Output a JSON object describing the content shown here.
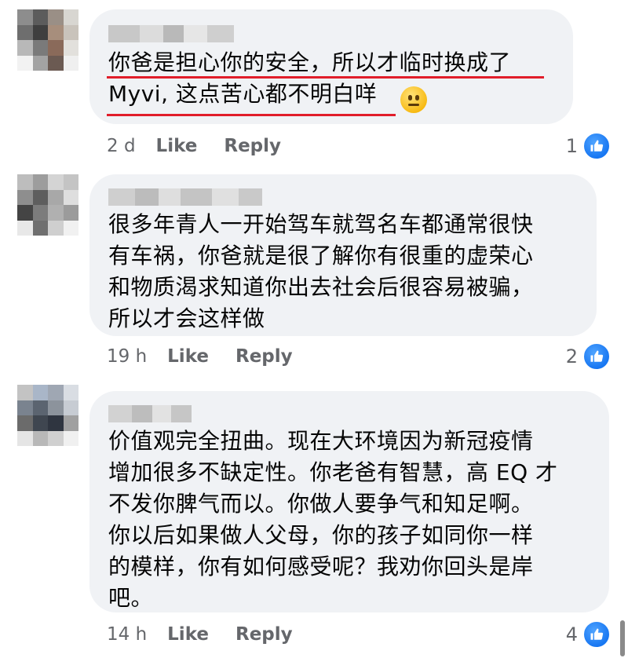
{
  "comments": [
    {
      "text": "你爸是担心你的安全，所以才临时换成了\nMyvi, 这点苦心都不明白咩",
      "emoji": "neutral-face-emoji",
      "time": "2 d",
      "like_label": "Like",
      "reply_label": "Reply",
      "reaction_count": "1"
    },
    {
      "text": "很多年青人一开始驾车就驾名车都通常很快\n有车祸，你爸就是很了解你有很重的虚荣心\n和物质渴求知道你出去社会后很容易被骗，\n所以才会这样做",
      "time": "19 h",
      "like_label": "Like",
      "reply_label": "Reply",
      "reaction_count": "2"
    },
    {
      "text": "价值观完全扭曲。现在大环境因为新冠疫情\n增加很多不缺定性。你老爸有智慧，高 EQ 才\n不发你脾气而以。你做人要争气和知足啊。\n你以后如果做人父母，你的孩子如同你一样\n的模样，你有如何感受呢？我劝你回头是岸\n吧。",
      "time": "14 h",
      "like_label": "Like",
      "reply_label": "Reply",
      "reaction_count": "4"
    }
  ],
  "colors": {
    "bubble": "#f0f2f5",
    "meta_text": "#65676b",
    "like_blue": "#1877f2",
    "underline_red": "#e11d2a"
  }
}
